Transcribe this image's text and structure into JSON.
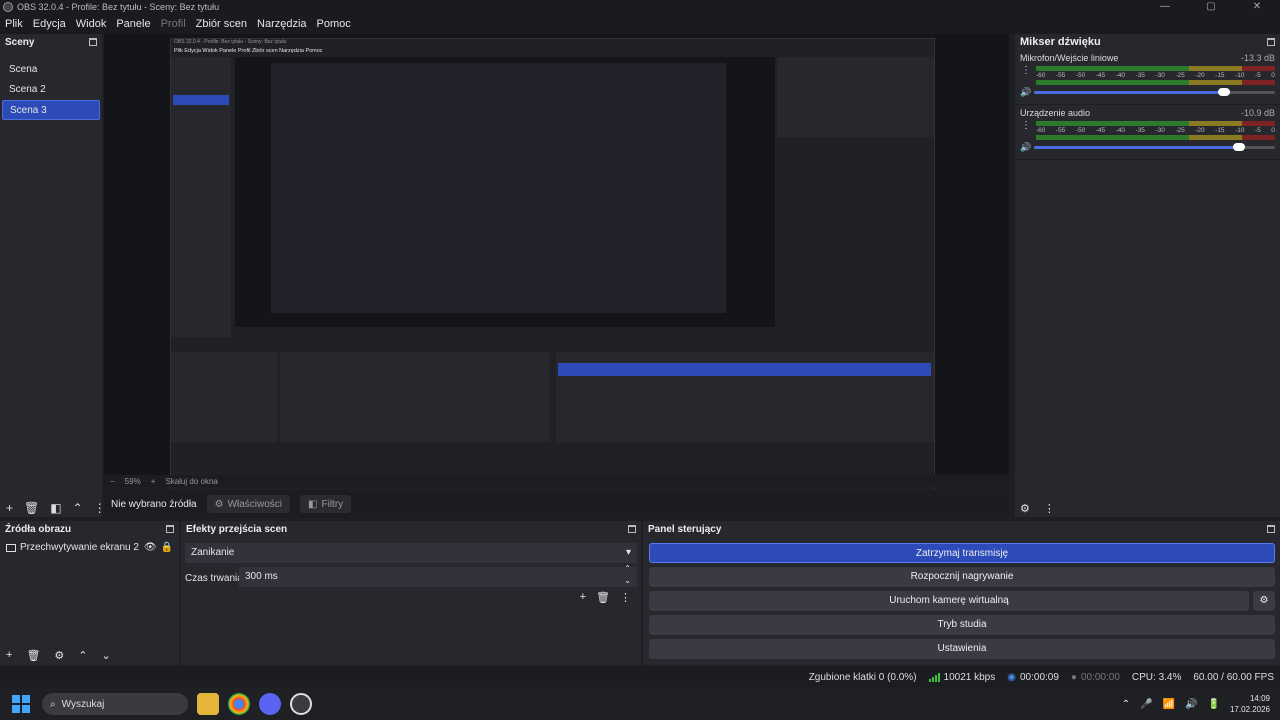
{
  "window": {
    "title": "OBS 32.0.4 - Profile: Bez tytułu - Sceny: Bez tytułu"
  },
  "menu": [
    "Plik",
    "Edycja",
    "Widok",
    "Panele",
    "Profil",
    "Zbiór scen",
    "Narzędzia",
    "Pomoc"
  ],
  "scenes": {
    "header": "Sceny",
    "items": [
      "Scena",
      "Scena 2",
      "Scena 3"
    ],
    "selected": 2
  },
  "preview": {
    "zoom": "59%",
    "zoom_mode": "Skaluj do okna"
  },
  "source_bar": {
    "none_selected": "Nie wybrano źródła",
    "properties": "Właściwości",
    "filters": "Filtry"
  },
  "mixer": {
    "header": "Mikser dźwięku",
    "ticks": [
      "-60",
      "-55",
      "-50",
      "-45",
      "-40",
      "-35",
      "-30",
      "-25",
      "-20",
      "-15",
      "-10",
      "-5",
      "0"
    ],
    "channels": [
      {
        "name": "Mikrofon/Wejście liniowe",
        "db": "-13.3 dB",
        "volume": 0.79
      },
      {
        "name": "Urządzenie audio",
        "db": "-10.9 dB",
        "volume": 0.85
      }
    ]
  },
  "sources": {
    "header": "Źródła obrazu",
    "items": [
      {
        "name": "Przechwytywanie ekranu 2"
      }
    ]
  },
  "transitions": {
    "header": "Efekty przejścia scen",
    "selected": "Zanikanie",
    "duration_label": "Czas trwania",
    "duration": "300 ms"
  },
  "controls": {
    "header": "Panel sterujący",
    "buttons": [
      "Zatrzymaj transmisję",
      "Rozpocznij nagrywanie",
      "Uruchom kamerę wirtualną",
      "Tryb studia",
      "Ustawienia"
    ],
    "active": 0
  },
  "status": {
    "dropped": "Zgubione klatki 0 (0.0%)",
    "bitrate": "10021 kbps",
    "stream_time": "00:00:09",
    "rec_time": "00:00:00",
    "cpu": "CPU: 3.4%",
    "fps": "60.00 / 60.00 FPS"
  },
  "taskbar": {
    "search": "Wyszukaj",
    "time": "14:09",
    "date": "17.02.2026"
  },
  "colors": {
    "accent": "#2c4bb8",
    "panel": "#27282d",
    "background": "#1e1f22",
    "meter_green": "#2d7a2b",
    "meter_yellow": "#8a7a22",
    "meter_red": "#7d2323"
  }
}
